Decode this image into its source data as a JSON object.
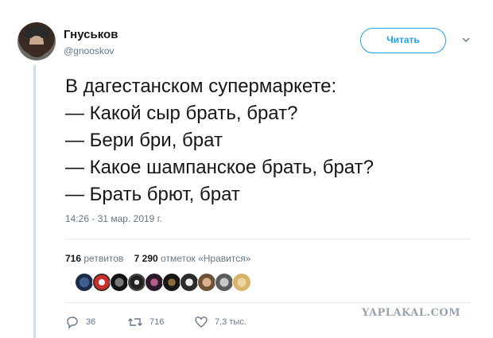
{
  "author": {
    "display_name": "Гнуськов",
    "handle": "@gnooskov"
  },
  "follow_button": {
    "label": "Читать"
  },
  "tweet": {
    "lines": [
      "В дагестанском супермаркете:",
      "— Какой сыр брать, брат?",
      "— Бери бри, брат",
      "— Какое шампанское брать, брат?",
      "— Брать брют, брат"
    ],
    "timestamp": "14:26 - 31 мар. 2019 г."
  },
  "stats": {
    "retweets_count": "716",
    "retweets_label": "ретвитов",
    "likes_count": "7 290",
    "likes_label": "отметок «Нравится»"
  },
  "actions": {
    "replies": "36",
    "retweets": "716",
    "likes": "7,3 тыс."
  },
  "watermark": "YAPLAKAL.COM",
  "colors": {
    "accent": "#1da1f2",
    "secondary_text": "#657786",
    "thread_line": "#cfe0ed"
  }
}
